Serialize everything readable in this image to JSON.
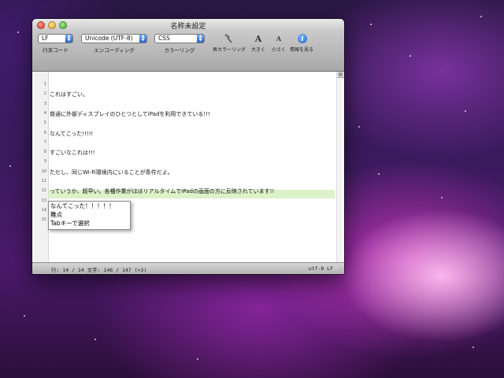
{
  "window": {
    "title": "名称未設定"
  },
  "toolbar": {
    "line_ending": {
      "value": "LF",
      "label": "行末コード"
    },
    "encoding": {
      "value": "Unicode (UTF-8)",
      "label": "エンコーディング"
    },
    "coloring": {
      "value": "CSS",
      "label": "カラーリング"
    },
    "buttons": [
      {
        "label": "再カラーリング",
        "icon": "recolor-brush-icon"
      },
      {
        "label": "大きく",
        "icon": "font-bigger-icon"
      },
      {
        "label": "小さく",
        "icon": "font-smaller-icon"
      },
      {
        "label": "情報を見る",
        "icon": "info-icon"
      }
    ],
    "bigger_glyph": "A",
    "smaller_glyph": "A",
    "info_glyph": "i"
  },
  "editor": {
    "lines": [
      {
        "n": "1",
        "text": ""
      },
      {
        "n": "2",
        "text": "これはすごい。"
      },
      {
        "n": "3",
        "text": ""
      },
      {
        "n": "4",
        "text": "普通に外部ディスプレイのひとつとしてiPadを利用できている!!!"
      },
      {
        "n": "5",
        "text": ""
      },
      {
        "n": "6",
        "text": "なんてこった!!!!!"
      },
      {
        "n": "7",
        "text": ""
      },
      {
        "n": "8",
        "text": "すごいなこれは!!!"
      },
      {
        "n": "9",
        "text": ""
      },
      {
        "n": "10",
        "text": "ただし、同じWi-Fi環境内にいることが条件だよ。"
      },
      {
        "n": "11",
        "text": ""
      },
      {
        "n": "12",
        "text": "っていうか、超早い。各種作業がほぼリアルタイムでiPadの画面の方に反映されています!!"
      },
      {
        "n": "13",
        "text": ""
      },
      {
        "n": "14",
        "text": "なんて"
      },
      {
        "n": "15",
        "text": ""
      }
    ],
    "highlight_color": "#dcf2c8"
  },
  "completion_popup": {
    "items": [
      "なんてこった！！！！！",
      "難点",
      "Tabキーで選択"
    ]
  },
  "status": {
    "left": "行: 14 / 14   文字: 146 / 147 (>3)",
    "right": "utf-8 LF"
  }
}
